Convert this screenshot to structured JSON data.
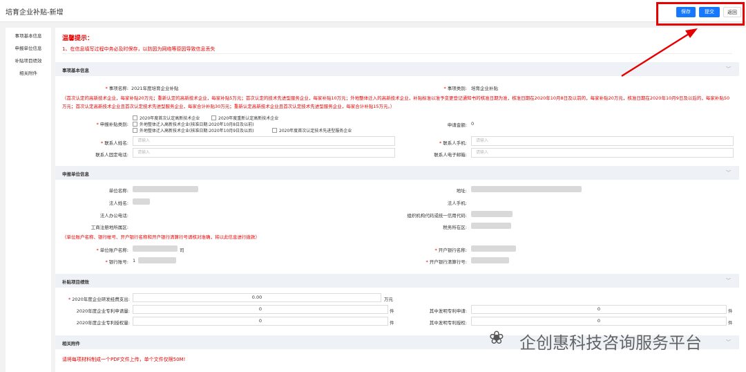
{
  "header": {
    "title": "培育企业补贴-新增",
    "save_label": "保存",
    "submit_label": "提交",
    "back_label": "返回"
  },
  "sidebar": {
    "items": [
      {
        "label": "事项基本信息"
      },
      {
        "label": "申报单位信息"
      },
      {
        "label": "补贴项目绩效"
      },
      {
        "label": "相关附件"
      }
    ]
  },
  "tip": {
    "title": "温馨提示：",
    "text": "1、在信息填写过程中务必及时保存，以防因为网络等原因导致信息丢失"
  },
  "basic": {
    "section_title": "事项基本信息",
    "item_name_label": "事项名称:",
    "item_name": "2021年度培育企业补贴",
    "item_type_label": "事项类别:",
    "item_type": "培育企业补贴",
    "note": "（首次认定的高新技术企业，每家补贴20万元；重新认定的高新技术企业，每家补贴5万元；首次认定的技术先进型服务企业，每家补贴10万元；外地整体迁入的高新技术企业，补贴标准以准予变更登记通知书的核准日期为准，核准日期在2020年10月8日及以前的，每家补贴20万元，核准日期在2020年10月9日及以后的，每家补贴50万元；首次认定高新技术企业且首次认定技术先进型服务企业，每家合计补贴30万元；重新认定高新技术企业且首次认定技术先进型服务企业，每家合计补贴15万元。）",
    "category_label": "申报补贴类别:",
    "options": [
      "2020年度首次认定高新技术企业",
      "2020年度重新认定高新技术企业",
      "外地整体迁入高新技术企业(核准日期:2020年10月8日及以前)",
      "外地整体迁入高新技术企业(核准日期:2020年10月9日及以后)",
      "2020年度首次认定技术先进型服务企业"
    ],
    "amount_label": "申请金额:",
    "amount": "0",
    "contact_name_label": "联系人姓名:",
    "contact_phone_label": "联系人手机:",
    "contact_tel_label": "联系人固定电话:",
    "contact_email_label": "联系人电子邮箱:",
    "placeholder": "请输入"
  },
  "unit": {
    "section_title": "申报单位信息",
    "name_label": "单位名称:",
    "address_label": "地址:",
    "legal_label": "法人姓名:",
    "legal_phone_label": "法人手机:",
    "office_phone_label": "法人办公电话:",
    "credit_code_label": "组织机构代码或统一信用代码:",
    "reg_area_label": "工商注册地所属区:",
    "tax_area_label": "税务所在区:",
    "bank_note": "（单位账户名称、银行帐号、开户银行名称和开户银行清算行号请核对准确，将以此信息进行拨款）",
    "account_name_label": "单位账户名称:",
    "account_name_suffix": "司",
    "bank_name_label": "开户银行名称:",
    "account_no_label": "银行账号:",
    "account_no_prefix": "1",
    "clearing_no_label": "开户银行清算行号:"
  },
  "perf": {
    "section_title": "补贴项目绩效",
    "rd_label": "2020年度企业研发经费支出:",
    "rd_value": "0.00",
    "rd_unit": "万元",
    "patent_apply_label": "2020年度企业专利申请量:",
    "patent_apply_value": "0",
    "invention_apply_label": "其中发明专利申请:",
    "invention_apply_value": "0",
    "patent_grant_label": "2020年度企业专利授权量:",
    "patent_grant_value": "0",
    "invention_grant_label": "其中发明专利授权:",
    "invention_grant_value": "0",
    "unit_piece": "件"
  },
  "attach": {
    "section_title": "相关附件",
    "note": "请将每项材料制成一个PDF文件上传，单个文件仅限50M!"
  },
  "watermark": {
    "text": "企创惠科技咨询服务平台",
    "icon": "wechat-icon"
  },
  "colors": {
    "primary": "#1677ff",
    "warning": "#e60000",
    "section_bg": "#eef1f6"
  }
}
